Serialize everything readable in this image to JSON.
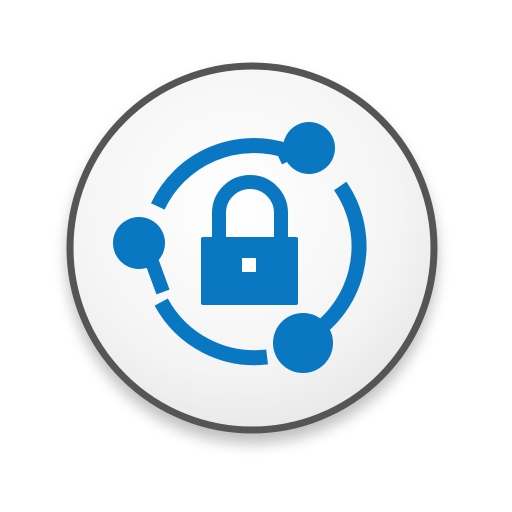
{
  "icon": {
    "name": "secure-network-lock-icon",
    "parts": [
      "circular-badge",
      "orbit-ring",
      "network-node",
      "padlock-icon",
      "keyhole"
    ]
  },
  "colors": {
    "accent": "#0a77c2",
    "badge_border": "#555555",
    "badge_fill_light": "#ffffff",
    "badge_fill_dark": "#e7e7e7",
    "page_background": "#ffffff"
  }
}
